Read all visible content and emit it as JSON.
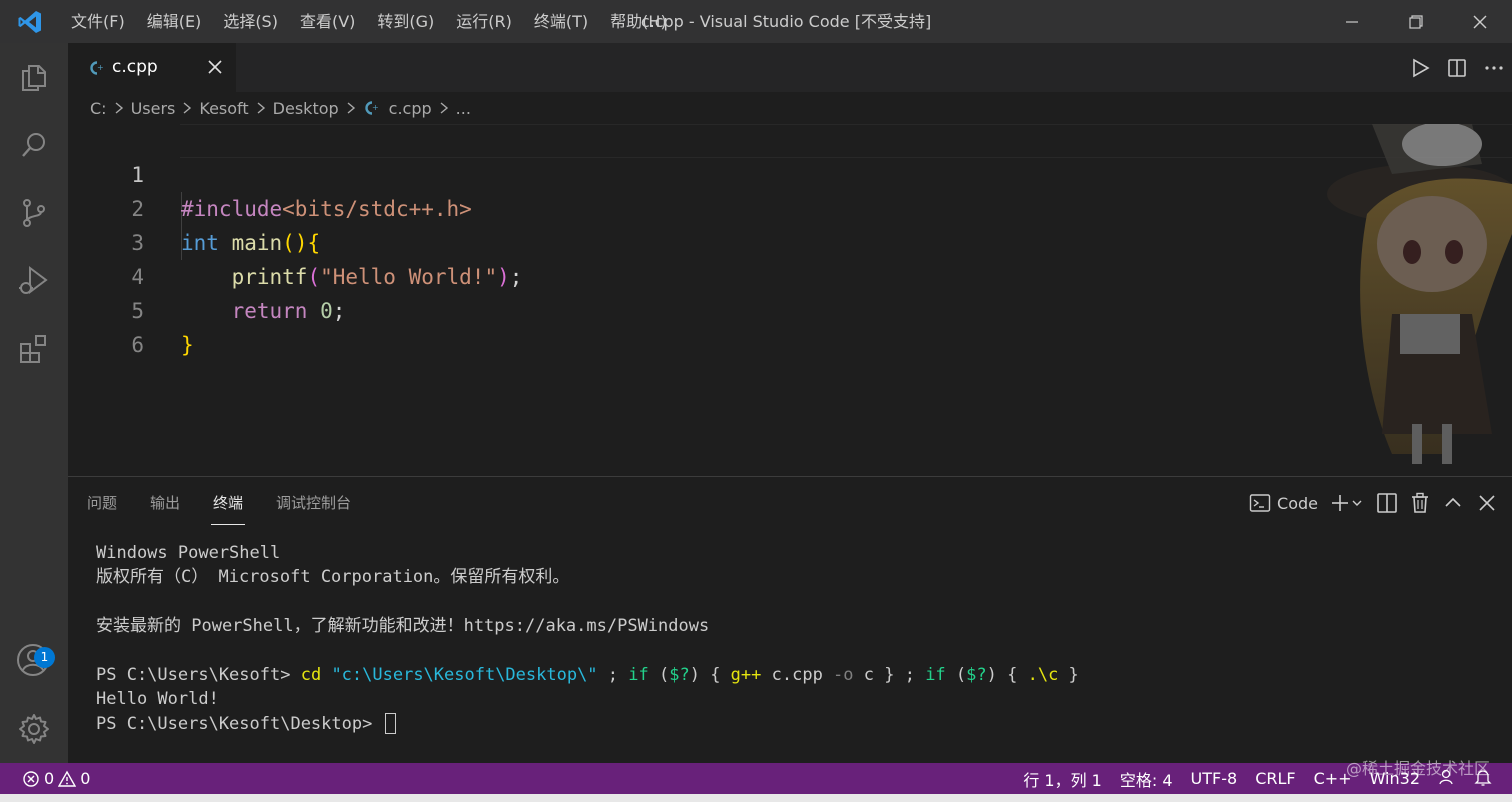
{
  "window": {
    "title": "c.cpp - Visual Studio Code [不受支持]",
    "menu": [
      "文件(F)",
      "编辑(E)",
      "选择(S)",
      "查看(V)",
      "转到(G)",
      "运行(R)",
      "终端(T)",
      "帮助(H)"
    ]
  },
  "activity_bar": {
    "items": [
      "explorer-icon",
      "search-icon",
      "source-control-icon",
      "run-debug-icon",
      "extensions-icon"
    ],
    "accounts_badge": "1"
  },
  "tabs": [
    {
      "label": "c.cpp",
      "active": true
    }
  ],
  "breadcrumb": [
    "C:",
    "Users",
    "Kesoft",
    "Desktop",
    "c.cpp",
    "..."
  ],
  "editor": {
    "line_numbers": [
      "1",
      "2",
      "3",
      "4",
      "5",
      "6"
    ],
    "lines": {
      "l1_directive": "#include",
      "l1_header": "<bits/stdc++.h>",
      "l2_type": "int",
      "l2_fn": "main",
      "l2_paren": "()",
      "l2_brace": "{",
      "l3_fn": "printf",
      "l3_open": "(",
      "l3_str": "\"Hello World!\"",
      "l3_close": ")",
      "l3_semi": ";",
      "l4_kw": "return",
      "l4_num": "0",
      "l4_semi": ";",
      "l5_brace": "}"
    }
  },
  "panel": {
    "tabs": [
      "问题",
      "输出",
      "终端",
      "调试控制台"
    ],
    "active_tab": "终端",
    "terminal_profile": "Code",
    "terminal": {
      "l1": "Windows PowerShell",
      "l2": "版权所有（C） Microsoft Corporation。保留所有权利。",
      "l3": "",
      "l4": "安装最新的 PowerShell，了解新功能和改进！https://aka.ms/PSWindows",
      "l5": "",
      "l6_prompt": "PS C:\\Users\\Kesoft> ",
      "l6_cd": "cd",
      "l6_path": "\"c:\\Users\\Kesoft\\Desktop\\\"",
      "l6_a": " ; ",
      "l6_if1": "if",
      "l6_b": " (",
      "l6_q1": "$?",
      "l6_c": ") { ",
      "l6_gpp": "g++",
      "l6_d": " c.cpp ",
      "l6_o": "-o",
      "l6_e": " c } ; ",
      "l6_if2": "if",
      "l6_f": " (",
      "l6_q2": "$?",
      "l6_g": ") { ",
      "l6_exe": ".\\c",
      "l6_h": " }",
      "l7": "Hello World!",
      "l8_prompt": "PS C:\\Users\\Kesoft\\Desktop> "
    }
  },
  "status_bar": {
    "errors": "0",
    "warnings": "0",
    "position": "行 1，列 1",
    "spaces": "空格: 4",
    "encoding": "UTF-8",
    "eol": "CRLF",
    "language": "C++",
    "platform": "Win32"
  },
  "watermark": "@稀土掘金技术社区",
  "colors": {
    "status_bar": "#68217a",
    "activity_bar": "#333333",
    "editor_bg": "#1e1e1e",
    "badge": "#0078d4"
  }
}
